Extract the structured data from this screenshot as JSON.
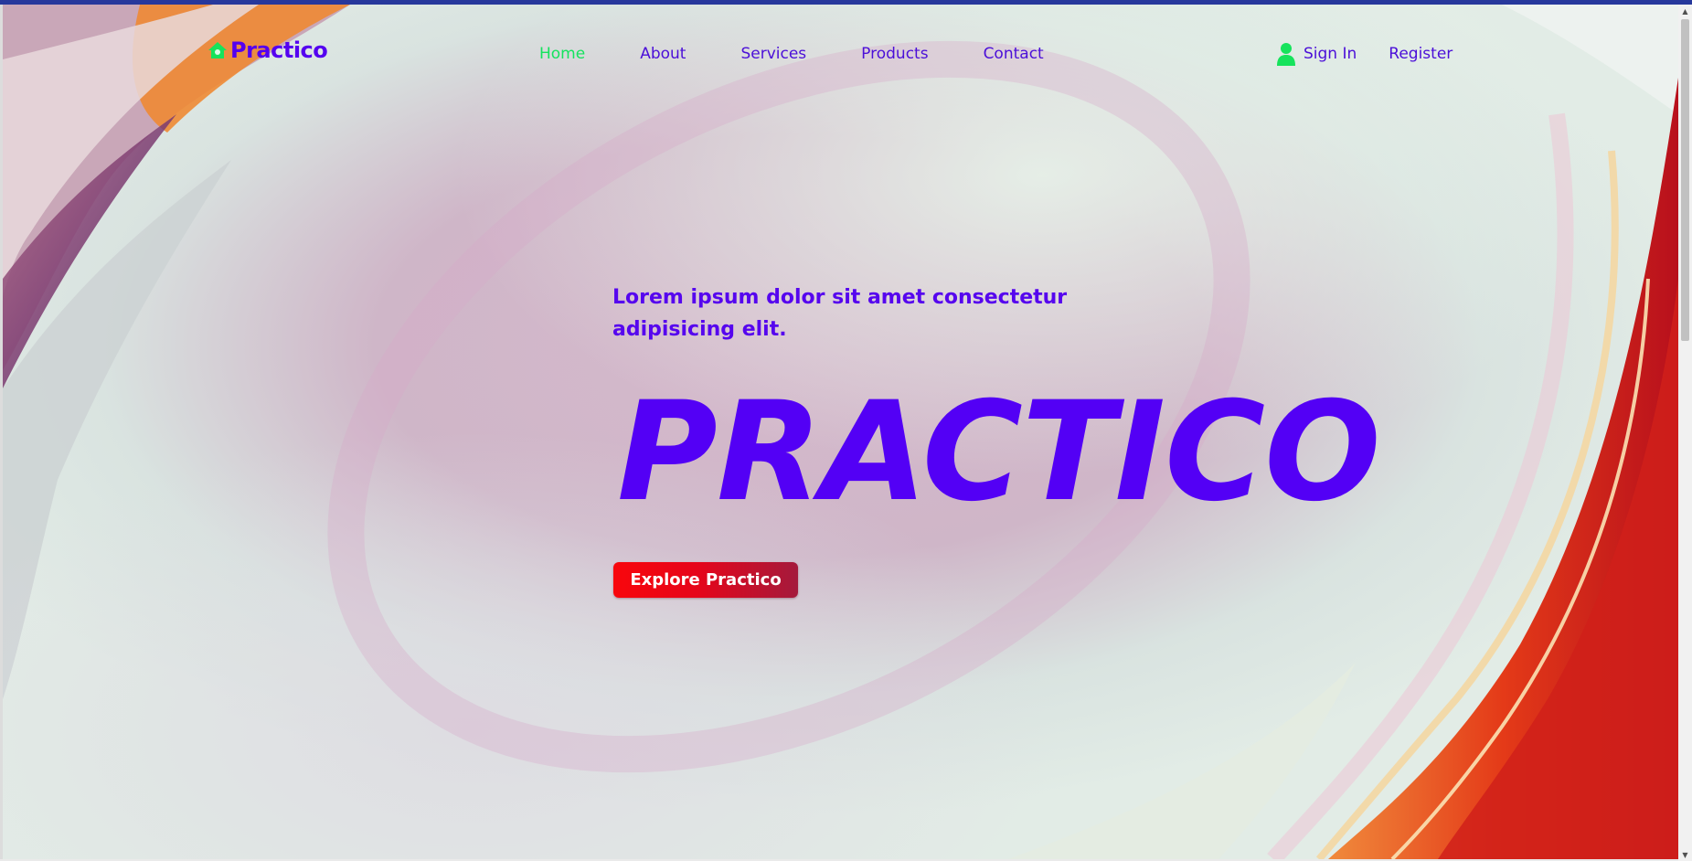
{
  "brand": {
    "name": "Practico",
    "icon": "home-icon",
    "icon_color": "#16e35c",
    "color": "#5400f0"
  },
  "nav": {
    "links": [
      {
        "label": "Home",
        "active": true
      },
      {
        "label": "About",
        "active": false
      },
      {
        "label": "Services",
        "active": false
      },
      {
        "label": "Products",
        "active": false
      },
      {
        "label": "Contact",
        "active": false
      }
    ],
    "active_color": "#14e35d",
    "link_color": "#4b0fd8"
  },
  "auth": {
    "sign_in_label": "Sign In",
    "sign_in_icon": "user-icon",
    "register_label": "Register"
  },
  "hero": {
    "tagline_line1": "Lorem ipsum dolor sit amet consectetur",
    "tagline_line2": "adipisicing elit.",
    "title": "PRACTICO",
    "cta_label": "Explore Practico",
    "title_color": "#5300f5",
    "cta_color": "#f8060c"
  }
}
